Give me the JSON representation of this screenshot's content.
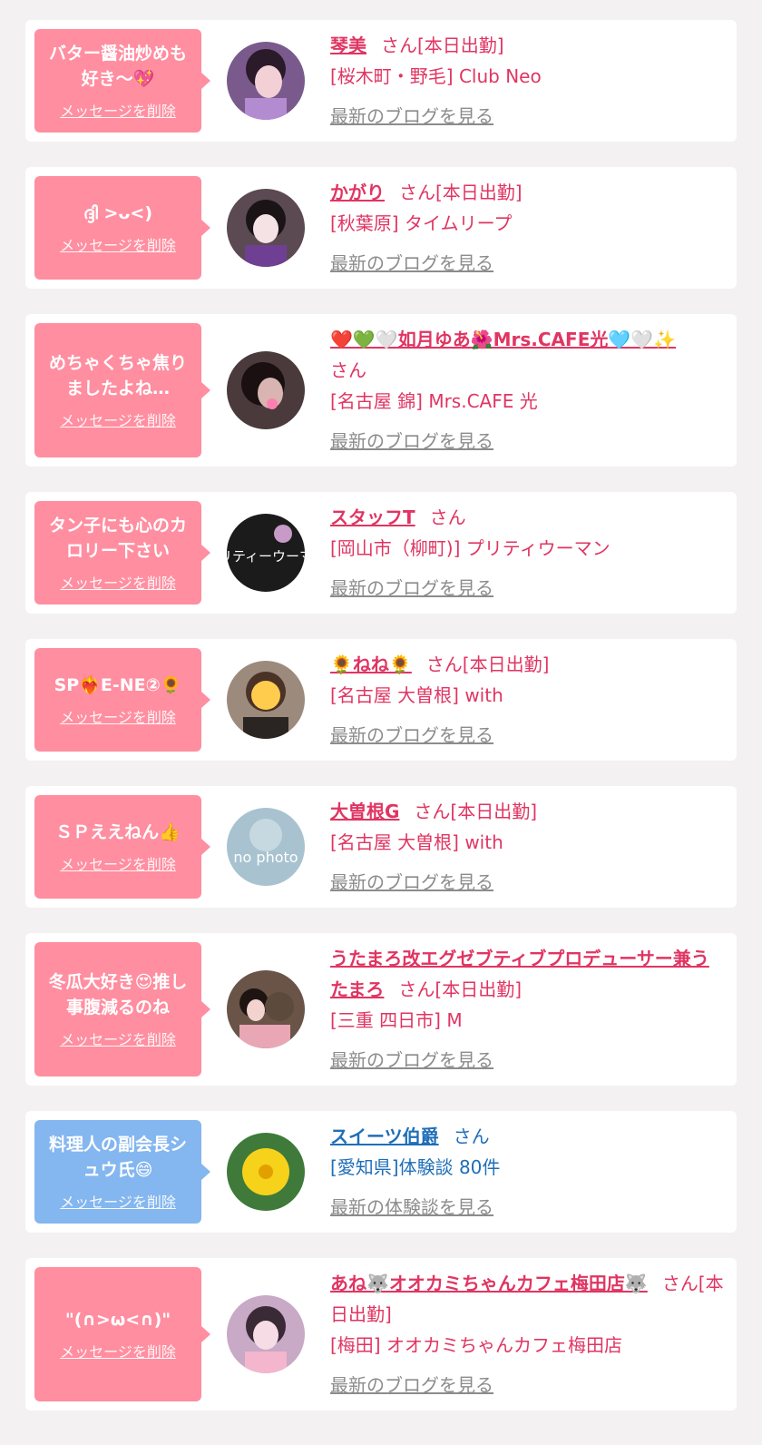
{
  "delete_label": "メッセージを削除",
  "cards": [
    {
      "message": "バター醤油炒めも\n好き〜💖",
      "name": "琴美",
      "suffix": "さん[本日出勤]",
      "shop": "[桜木町・野毛] Club Neo",
      "link": "最新のブログを見る",
      "color": "pink"
    },
    {
      "message": "ദ്ദി >ᴗ<)",
      "name": "かがり",
      "suffix": "さん[本日出勤]",
      "shop": "[秋葉原] タイムリープ",
      "link": "最新のブログを見る",
      "color": "pink"
    },
    {
      "message": "めちゃくちゃ焦り\nましたよね…",
      "name": "❤️💚🤍如月ゆあ🌺Mrs.CAFE光🩵🤍✨",
      "suffix": "さん",
      "shop": "[名古屋 錦] Mrs.CAFE 光",
      "link": "最新のブログを見る",
      "color": "pink"
    },
    {
      "message": "タン子にも心のカ\nロリー下さい",
      "name": "スタッフT",
      "suffix": "さん",
      "shop": "[岡山市（柳町)] プリティウーマン",
      "link": "最新のブログを見る",
      "color": "pink"
    },
    {
      "message": "SP❤️‍🔥E-NE②🌻",
      "name": "🌻ねね🌻",
      "suffix": "さん[本日出勤]",
      "shop": "[名古屋 大曽根] with",
      "link": "最新のブログを見る",
      "color": "pink"
    },
    {
      "message": "ＳＰええねん👍",
      "name": "大曽根G",
      "suffix": "さん[本日出勤]",
      "shop": "[名古屋 大曽根] with",
      "link": "最新のブログを見る",
      "color": "pink"
    },
    {
      "message": "冬瓜大好き😍推し\n事腹減るのね",
      "name": "うたまろ改エグゼブティブプロデューサー兼うたまろ",
      "suffix": "さん[本日出勤]",
      "shop": "[三重 四日市] M",
      "link": "最新のブログを見る",
      "color": "pink"
    },
    {
      "message": "料理人の副会長シ\nュウ氏😄",
      "name": "スイーツ伯爵",
      "suffix": "さん",
      "shop": "[愛知県]体験談 80件",
      "link": "最新の体験談を見る",
      "color": "blue"
    },
    {
      "message": "\"(∩>ω<∩)\"",
      "name": "あね🐺オオカミちゃんカフェ梅田店🐺",
      "suffix": "さん[本日出勤]",
      "shop": "[梅田] オオカミちゃんカフェ梅田店",
      "link": "最新のブログを見る",
      "color": "pink"
    }
  ],
  "avatar_text": {
    "a3": "プリティーウーマン",
    "a5": "no photo"
  },
  "colors": {
    "pink_bubble": "#ff8ea0",
    "blue_bubble": "#84b6ef",
    "pink_text": "#e03562",
    "blue_text": "#1f6fb8",
    "link_gray": "#8c8c8c"
  }
}
